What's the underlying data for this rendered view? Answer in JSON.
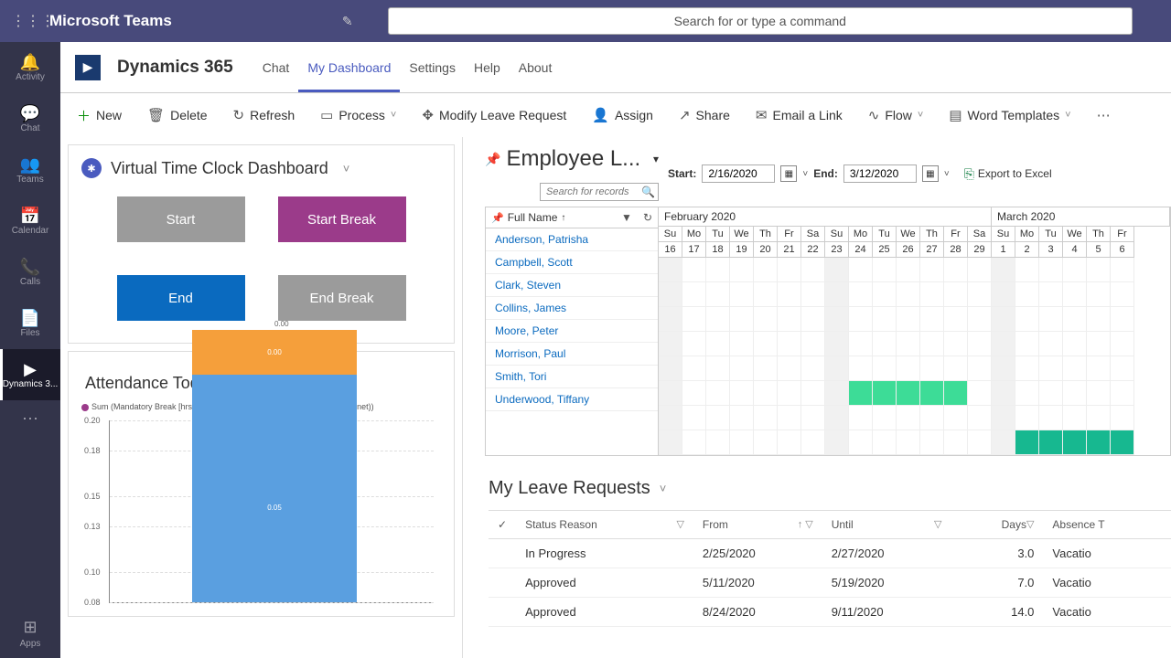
{
  "header": {
    "title": "Microsoft Teams",
    "search_placeholder": "Search for or type a command"
  },
  "rail": {
    "items": [
      {
        "label": "Activity",
        "icon": "🔔"
      },
      {
        "label": "Chat",
        "icon": "💬"
      },
      {
        "label": "Teams",
        "icon": "👥"
      },
      {
        "label": "Calendar",
        "icon": "📅"
      },
      {
        "label": "Calls",
        "icon": "📞"
      },
      {
        "label": "Files",
        "icon": "📄"
      },
      {
        "label": "Dynamics 3...",
        "icon": "▶"
      }
    ],
    "apps_label": "Apps"
  },
  "d365": {
    "app_name": "Dynamics 365",
    "tabs": [
      "Chat",
      "My Dashboard",
      "Settings",
      "Help",
      "About"
    ],
    "active_tab": "My Dashboard"
  },
  "toolbar": {
    "new": "New",
    "delete": "Delete",
    "refresh": "Refresh",
    "process": "Process",
    "modify": "Modify Leave Request",
    "assign": "Assign",
    "share": "Share",
    "email": "Email a Link",
    "flow": "Flow",
    "word": "Word Templates"
  },
  "clock": {
    "title": "Virtual Time Clock Dashboard",
    "start": "Start",
    "start_break": "Start Break",
    "end": "End",
    "end_break": "End Break"
  },
  "attendance": {
    "title": "Attendance Today",
    "legend_mandatory": "Sum (Mandatory Break [hrs])",
    "legend_breaks": "Sum (Breaks [hrs])",
    "legend_hours": "Sum (Hours (net))"
  },
  "chart_data": {
    "type": "bar",
    "ylim": [
      0.08,
      0.2
    ],
    "ticks": [
      0.2,
      0.18,
      0.15,
      0.13,
      0.1,
      0.08
    ],
    "segments": [
      {
        "color": "#f59f3b",
        "value": 0.03,
        "label": "0.00"
      },
      {
        "color": "#5a9fe0",
        "value": 0.15,
        "label": "0.05"
      }
    ],
    "top_label": "0.00"
  },
  "schedule": {
    "title": "Employee L...",
    "start_label": "Start:",
    "start_value": "2/16/2020",
    "end_label": "End:",
    "end_value": "3/12/2020",
    "export": "Export to Excel",
    "search_placeholder": "Search for records",
    "fullname_header": "Full Name",
    "month1": "February 2020",
    "month2": "March 2020",
    "days": [
      "Su",
      "Mo",
      "Tu",
      "We",
      "Th",
      "Fr",
      "Sa",
      "Su",
      "Mo",
      "Tu",
      "We",
      "Th",
      "Fr",
      "Sa",
      "Su",
      "Mo",
      "Tu",
      "We",
      "Th",
      "Fr"
    ],
    "dates": [
      "16",
      "17",
      "18",
      "19",
      "20",
      "21",
      "22",
      "23",
      "24",
      "25",
      "26",
      "27",
      "28",
      "29",
      "1",
      "2",
      "3",
      "4",
      "5",
      "6"
    ],
    "employees": [
      "Anderson, Patrisha",
      "Campbell, Scott",
      "Clark, Steven",
      "Collins, James",
      "Moore, Peter",
      "Morrison, Paul",
      "Smith, Tori",
      "Underwood, Tiffany"
    ],
    "morrison_fill": [
      8,
      9,
      10,
      11,
      12
    ],
    "underwood_fill": [
      15,
      16,
      17,
      18,
      19
    ]
  },
  "leave": {
    "title": "My Leave Requests",
    "columns": {
      "status": "Status Reason",
      "from": "From",
      "until": "Until",
      "days": "Days",
      "absence": "Absence T"
    },
    "rows": [
      {
        "status": "In Progress",
        "from": "2/25/2020",
        "until": "2/27/2020",
        "days": "3.0",
        "absence": "Vacatio"
      },
      {
        "status": "Approved",
        "from": "5/11/2020",
        "until": "5/19/2020",
        "days": "7.0",
        "absence": "Vacatio"
      },
      {
        "status": "Approved",
        "from": "8/24/2020",
        "until": "9/11/2020",
        "days": "14.0",
        "absence": "Vacatio"
      }
    ]
  }
}
